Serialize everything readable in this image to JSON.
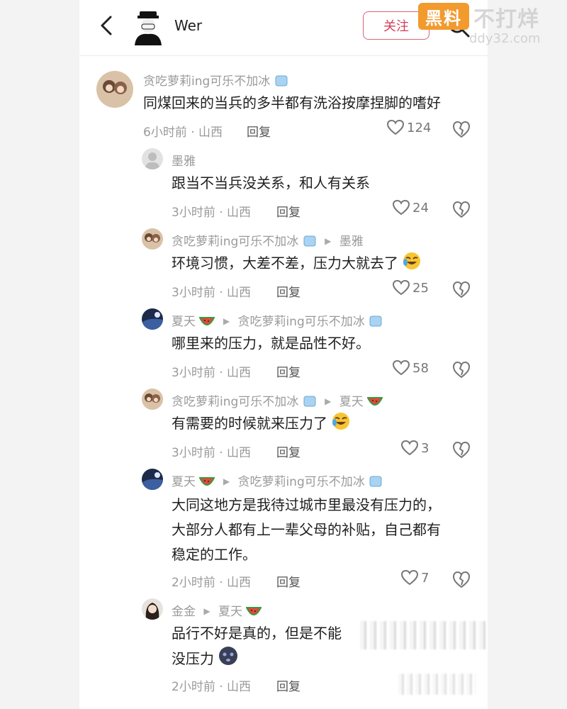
{
  "header": {
    "username": "Wer",
    "follow_label": "关注"
  },
  "watermark": {
    "badge": "黑料",
    "text": "不打烊",
    "url": "ddy32.com"
  },
  "comments": [
    {
      "user": "贪吃萝莉ing可乐不加冰",
      "text": [
        "同煤回来的当兵的多半都有洗浴按摩捏脚的嗜好"
      ],
      "time": "6小时前 · 山西",
      "reply": "回复",
      "likes": "124"
    },
    {
      "user": "墨雅",
      "text": [
        "跟当不当兵没关系，和人有关系"
      ],
      "time": "3小时前 · 山西",
      "reply": "回复",
      "likes": "24"
    },
    {
      "user": "贪吃萝莉ing可乐不加冰",
      "reply_to": "墨雅",
      "text": [
        "环境习惯，大差不差，压力大就去了"
      ],
      "time": "3小时前 · 山西",
      "reply": "回复",
      "likes": "25"
    },
    {
      "user": "夏天",
      "reply_to": "贪吃萝莉ing可乐不加冰",
      "text": [
        "哪里来的压力，就是品性不好。"
      ],
      "time": "3小时前 · 山西",
      "reply": "回复",
      "likes": "58"
    },
    {
      "user": "贪吃萝莉ing可乐不加冰",
      "reply_to": "夏天",
      "text": [
        "有需要的时候就来压力了"
      ],
      "time": "3小时前 · 山西",
      "reply": "回复",
      "likes": "3"
    },
    {
      "user": "夏天",
      "reply_to": "贪吃萝莉ing可乐不加冰",
      "text": [
        "大同这地方是我待过城市里最没有压力的，",
        "大部分人都有上一辈父母的补贴，自己都有",
        "稳定的工作。"
      ],
      "time": "2小时前 · 山西",
      "reply": "回复",
      "likes": "7"
    },
    {
      "user": "金金",
      "reply_to": "夏天",
      "text": [
        "品行不好是真的，但是不能",
        "没压力"
      ],
      "time": "2小时前 · 山西",
      "reply": "回复",
      "likes": ""
    }
  ],
  "colors": {
    "follow_border": "#d8667a",
    "watermark_orange": "#f29a2e"
  },
  "icons": [
    "back-arrow-icon",
    "search-icon",
    "heart-icon",
    "dislike-icon",
    "ice-emoji",
    "watermelon-emoji",
    "laughing-crying-emoji",
    "dizzy-face-emoji"
  ]
}
